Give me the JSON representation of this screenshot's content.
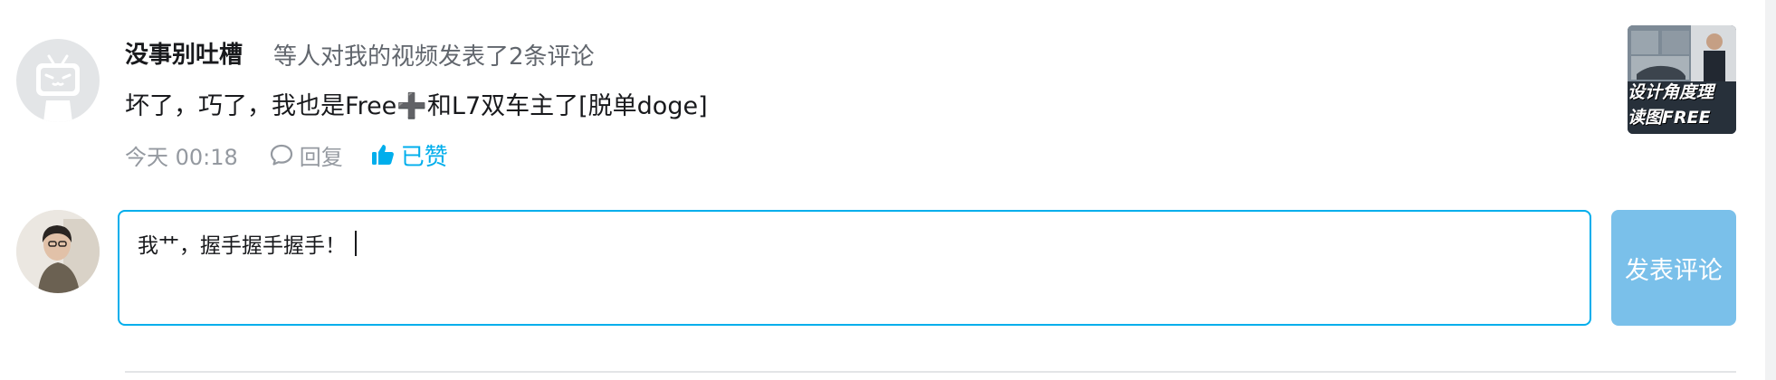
{
  "comment": {
    "username": "没事别吐槽",
    "notification": "等人对我的视频发表了2条评论",
    "text": "坏了，巧了，我也是Free➕和L7双车主了[脱单doge]",
    "time": "今天 00:18",
    "reply_label": "回复",
    "liked_label": "已赞",
    "avatar_icon": "bilibili-tv-icon",
    "video_thumbnail_caption": "设计角度理 读图FREE"
  },
  "reply_box": {
    "value": "我艹，握手握手握手！",
    "submit_label": "发表评论"
  },
  "colors": {
    "accent": "#00aeec",
    "submit_bg": "#7ac0ea",
    "muted_text": "#9499a0"
  }
}
